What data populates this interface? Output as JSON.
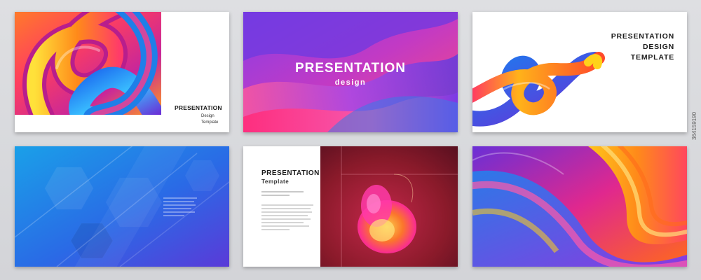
{
  "slides": {
    "slide1": {
      "title": "PRESENTATION",
      "line2": "Design",
      "line3": "Template"
    },
    "slide2": {
      "title": "PRESENTATION",
      "subtitle": "design"
    },
    "slide3": {
      "line1": "PRESENTATION",
      "line2": "DESIGN",
      "line3": "TEMPLATE"
    },
    "slide5": {
      "title": "PRESENTATION",
      "subtitle": "Template"
    }
  },
  "stock_id": "364159190",
  "colors": {
    "page_bg": "#d8d9dc",
    "magenta": "#e0288e",
    "purple": "#6a2fd6",
    "blue": "#1f6fe0",
    "yellow": "#ffd21a",
    "orange": "#ff6a1a"
  }
}
